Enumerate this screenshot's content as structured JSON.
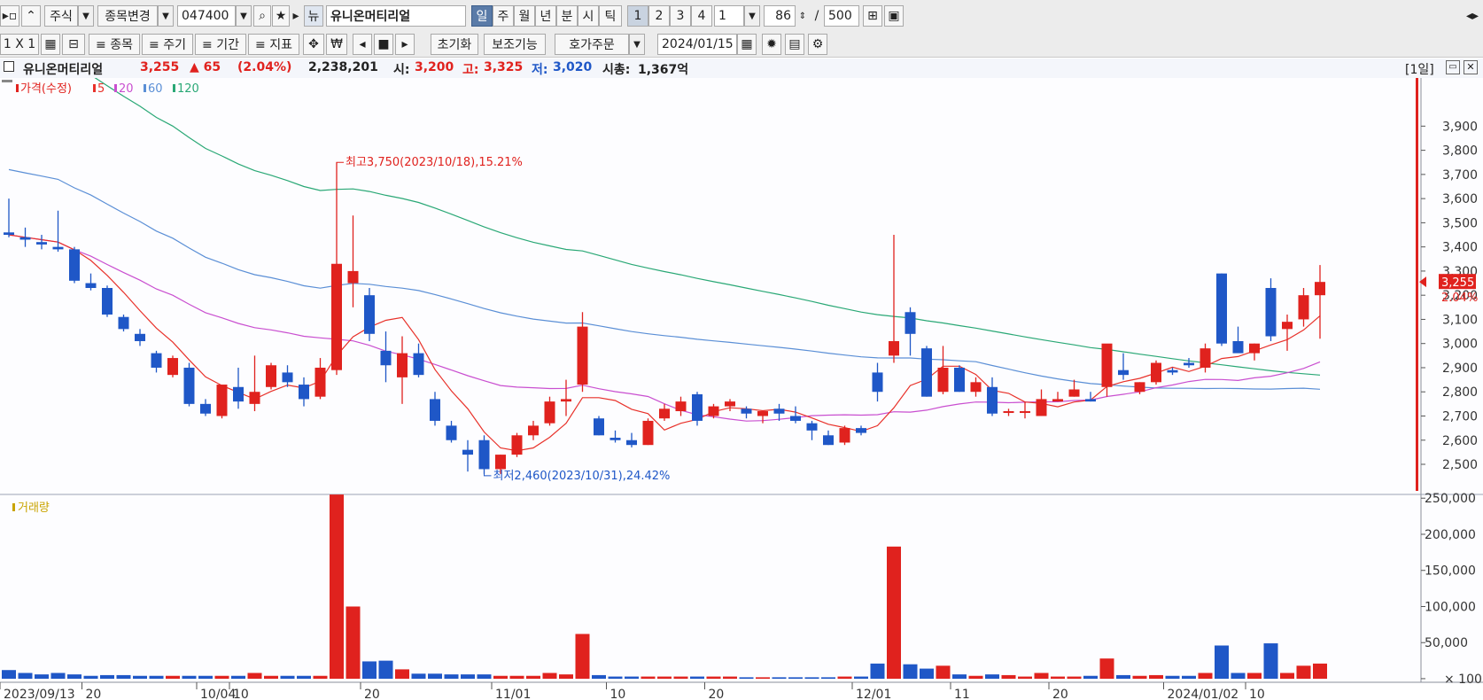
{
  "toolbar": {
    "market": "주식",
    "change_item": "종목변경",
    "code": "047400",
    "news_icon": "뉴",
    "stock_name": "유니온머티리얼",
    "periods": [
      "일",
      "주",
      "월",
      "년",
      "분",
      "시",
      "틱"
    ],
    "active_period": "일",
    "nums": [
      "1",
      "2",
      "3",
      "4"
    ],
    "interval": "1",
    "count": "86",
    "count_sep": "/",
    "max_count": "500",
    "layout": "1 X 1",
    "tools": [
      "≡ 종목",
      "≡ 주기",
      "≡ 기간",
      "≡ 지표"
    ],
    "reset": "초기화",
    "aux": "보조기능",
    "order": "호가주문",
    "date": "2024/01/15"
  },
  "info": {
    "name": "유니온머티리얼",
    "price": "3,255",
    "change": "▲ 65",
    "change_pct": "(2.04%)",
    "volume": "2,238,201",
    "open_label": "시:",
    "open": "3,200",
    "high_label": "고:",
    "high": "3,325",
    "low_label": "저:",
    "low": "3,020",
    "mcap_label": "시총:",
    "mcap": "1,367억",
    "period_badge": "[1일]"
  },
  "colors": {
    "up": "#e0221e",
    "down": "#1f57c7",
    "ma5": "#e8312a",
    "ma20": "#c94fd0",
    "ma60": "#5b8fd6",
    "ma120": "#2aa876",
    "vol_legend": "#c9a400"
  },
  "chart_data": [
    {
      "type": "candlestick",
      "legend": [
        "가격(수정)",
        "5",
        "20",
        "60",
        "120"
      ],
      "current_price": "3,255",
      "current_pct": "2.04%",
      "yticks": [
        2500,
        2600,
        2700,
        2800,
        2900,
        3000,
        3100,
        3200,
        3300,
        3400,
        3500,
        3600,
        3700,
        3800,
        3900
      ],
      "ylim": [
        2390,
        4070
      ],
      "xlabels": [
        {
          "i": 0,
          "label": "2023/09/13"
        },
        {
          "i": 5,
          "label": "20"
        },
        {
          "i": 12,
          "label": "10/04"
        },
        {
          "i": 14,
          "label": "10"
        },
        {
          "i": 22,
          "label": "20"
        },
        {
          "i": 30,
          "label": "11/01"
        },
        {
          "i": 37,
          "label": "10"
        },
        {
          "i": 43,
          "label": "20"
        },
        {
          "i": 52,
          "label": "12/01"
        },
        {
          "i": 58,
          "label": "11"
        },
        {
          "i": 64,
          "label": "20"
        },
        {
          "i": 71,
          "label": "2024/01/02"
        },
        {
          "i": 76,
          "label": "10"
        }
      ],
      "annotations": [
        {
          "i": 20,
          "price": 3750,
          "text": "최고3,750(2023/10/18),15.21%"
        },
        {
          "i": 29,
          "price": 2460,
          "text": "최저2,460(2023/10/31),24.42%"
        }
      ],
      "candles": [
        [
          3460,
          3600,
          3440,
          3450
        ],
        [
          3440,
          3480,
          3400,
          3430
        ],
        [
          3420,
          3450,
          3390,
          3410
        ],
        [
          3400,
          3550,
          3380,
          3390
        ],
        [
          3390,
          3400,
          3250,
          3260
        ],
        [
          3250,
          3290,
          3220,
          3230
        ],
        [
          3230,
          3240,
          3110,
          3120
        ],
        [
          3110,
          3120,
          3050,
          3060
        ],
        [
          3040,
          3060,
          2990,
          3010
        ],
        [
          2960,
          2970,
          2880,
          2900
        ],
        [
          2870,
          2950,
          2860,
          2940
        ],
        [
          2900,
          2920,
          2740,
          2750
        ],
        [
          2750,
          2770,
          2700,
          2710
        ],
        [
          2700,
          2820,
          2690,
          2830
        ],
        [
          2820,
          2900,
          2730,
          2760
        ],
        [
          2750,
          2950,
          2720,
          2800
        ],
        [
          2820,
          2920,
          2810,
          2910
        ],
        [
          2880,
          2910,
          2820,
          2840
        ],
        [
          2830,
          2860,
          2740,
          2770
        ],
        [
          2780,
          2940,
          2770,
          2900
        ],
        [
          2890,
          3750,
          2870,
          3330
        ],
        [
          3250,
          3530,
          3150,
          3300
        ],
        [
          3200,
          3230,
          3010,
          3040
        ],
        [
          2970,
          3050,
          2840,
          2910
        ],
        [
          2860,
          3030,
          2750,
          2960
        ],
        [
          2960,
          3000,
          2860,
          2870
        ],
        [
          2770,
          2800,
          2660,
          2680
        ],
        [
          2660,
          2680,
          2590,
          2600
        ],
        [
          2560,
          2600,
          2470,
          2540
        ],
        [
          2600,
          2620,
          2460,
          2480
        ],
        [
          2480,
          2540,
          2460,
          2540
        ],
        [
          2540,
          2630,
          2530,
          2620
        ],
        [
          2620,
          2680,
          2600,
          2660
        ],
        [
          2670,
          2780,
          2660,
          2760
        ],
        [
          2760,
          2850,
          2700,
          2770
        ],
        [
          2830,
          3130,
          2800,
          3070
        ],
        [
          2690,
          2700,
          2620,
          2620
        ],
        [
          2610,
          2640,
          2590,
          2600
        ],
        [
          2600,
          2630,
          2570,
          2580
        ],
        [
          2580,
          2690,
          2580,
          2680
        ],
        [
          2690,
          2750,
          2680,
          2730
        ],
        [
          2720,
          2780,
          2700,
          2760
        ],
        [
          2790,
          2800,
          2660,
          2680
        ],
        [
          2700,
          2750,
          2690,
          2740
        ],
        [
          2740,
          2770,
          2720,
          2760
        ],
        [
          2730,
          2740,
          2690,
          2710
        ],
        [
          2700,
          2720,
          2670,
          2720
        ],
        [
          2730,
          2750,
          2680,
          2710
        ],
        [
          2700,
          2740,
          2670,
          2680
        ],
        [
          2670,
          2680,
          2600,
          2640
        ],
        [
          2620,
          2640,
          2580,
          2580
        ],
        [
          2590,
          2660,
          2580,
          2650
        ],
        [
          2650,
          2660,
          2620,
          2630
        ],
        [
          2880,
          2920,
          2760,
          2800
        ],
        [
          2950,
          3450,
          2920,
          3010
        ],
        [
          3130,
          3150,
          2950,
          3040
        ],
        [
          2980,
          2990,
          2780,
          2780
        ],
        [
          2800,
          2990,
          2790,
          2900
        ],
        [
          2900,
          2910,
          2800,
          2800
        ],
        [
          2800,
          2860,
          2780,
          2840
        ],
        [
          2820,
          2860,
          2700,
          2710
        ],
        [
          2720,
          2730,
          2700,
          2720
        ],
        [
          2720,
          2760,
          2690,
          2720
        ],
        [
          2700,
          2810,
          2700,
          2770
        ],
        [
          2760,
          2800,
          2760,
          2770
        ],
        [
          2780,
          2850,
          2780,
          2810
        ],
        [
          2770,
          2800,
          2760,
          2760
        ],
        [
          2820,
          2970,
          2780,
          3000
        ],
        [
          2890,
          2960,
          2850,
          2870
        ],
        [
          2800,
          2840,
          2790,
          2840
        ],
        [
          2840,
          2930,
          2830,
          2920
        ],
        [
          2890,
          2900,
          2870,
          2880
        ],
        [
          2920,
          2940,
          2900,
          2910
        ],
        [
          2900,
          3000,
          2880,
          2980
        ],
        [
          3290,
          3290,
          2990,
          3000
        ],
        [
          3010,
          3070,
          2970,
          2960
        ],
        [
          2960,
          3000,
          2930,
          3000
        ],
        [
          3230,
          3270,
          3010,
          3030
        ],
        [
          3060,
          3120,
          2970,
          3090
        ],
        [
          3100,
          3230,
          3070,
          3200
        ],
        [
          3200,
          3325,
          3020,
          3255
        ]
      ]
    },
    {
      "type": "bar",
      "title": "거래량",
      "yticks": [
        100,
        50000,
        100000,
        150000,
        200000,
        250000
      ],
      "ytick_labels": [
        "× 100",
        "50,000",
        "100,000",
        "150,000",
        "200,000",
        "250,000"
      ],
      "ylim": [
        0,
        265000
      ],
      "values": [
        12000,
        8000,
        6000,
        8000,
        6000,
        4000,
        5000,
        5000,
        4000,
        4000,
        4000,
        4000,
        4000,
        4000,
        4000,
        8000,
        4000,
        4000,
        4000,
        4000,
        255000,
        100000,
        24000,
        25000,
        13000,
        7000,
        7000,
        6000,
        6000,
        6000,
        4000,
        4000,
        4000,
        8000,
        6000,
        62000,
        5000,
        3000,
        3000,
        3000,
        3000,
        3000,
        3000,
        3000,
        3000,
        2000,
        2000,
        2000,
        2000,
        2000,
        2000,
        3000,
        3000,
        21000,
        183000,
        20000,
        14000,
        18000,
        6000,
        4000,
        6000,
        5000,
        3000,
        8000,
        3000,
        3000,
        4000,
        28000,
        5000,
        4000,
        5000,
        4000,
        4000,
        8000,
        46000,
        8000,
        8000,
        49000,
        8000,
        18000,
        21000
      ]
    }
  ]
}
